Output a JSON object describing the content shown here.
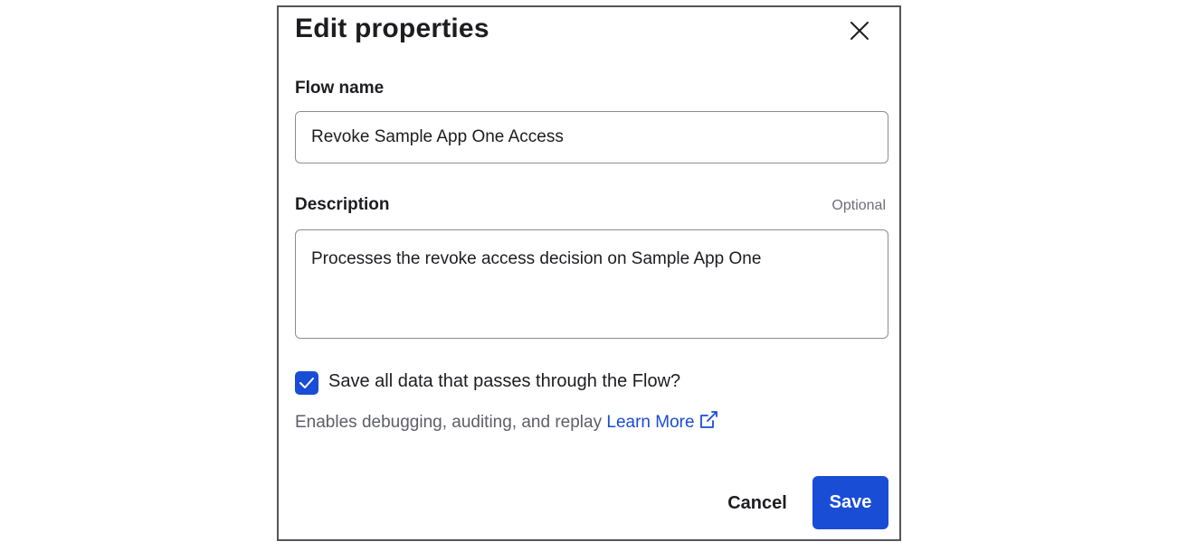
{
  "dialog": {
    "title": "Edit properties",
    "close_icon": "close-icon"
  },
  "flow_name": {
    "label": "Flow name",
    "value": "Revoke Sample App One Access"
  },
  "description": {
    "label": "Description",
    "optional_text": "Optional",
    "value": "Processes the revoke access decision on Sample App One"
  },
  "save_data": {
    "checked": true,
    "label": "Save all data that passes through the Flow?",
    "helper_text": "Enables debugging, auditing, and replay",
    "link_text": "Learn More",
    "link_icon": "external-link-icon"
  },
  "footer": {
    "cancel_label": "Cancel",
    "save_label": "Save"
  },
  "colors": {
    "accent": "#1a4dd6",
    "border": "#55555a",
    "muted_text": "#5e5e68"
  }
}
